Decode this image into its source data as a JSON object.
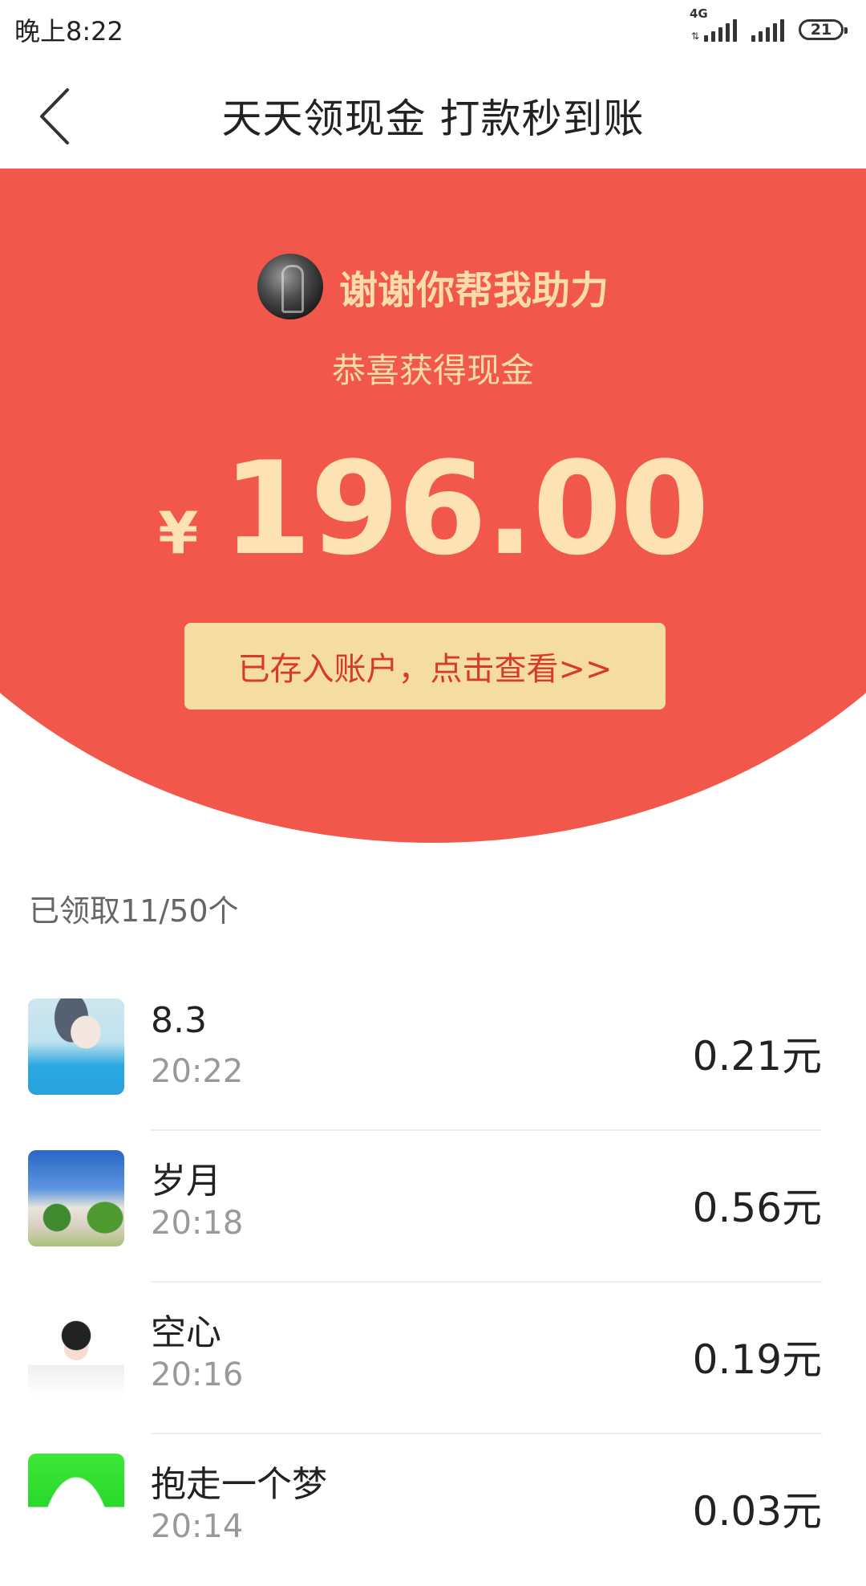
{
  "status_bar": {
    "time": "晚上8:22",
    "network_type": "4G",
    "battery": "21"
  },
  "header": {
    "title": "天天领现金 打款秒到账",
    "back_icon": "chevron-left-icon"
  },
  "hero": {
    "helper_text": "谢谢你帮我助力",
    "congrats": "恭喜获得现金",
    "currency_symbol": "¥",
    "amount": "196.00",
    "account_button": "已存入账户，点击查看>>",
    "bg_color": "#f1574a",
    "text_color": "#fde3b4",
    "button_color": "#f5dca1"
  },
  "received": {
    "label": "已领取11/50个"
  },
  "records": [
    {
      "name": "8.3",
      "time": "20:22",
      "amount": "0.21元"
    },
    {
      "name": "岁月",
      "time": "20:18",
      "amount": "0.56元"
    },
    {
      "name": "空心",
      "time": "20:16",
      "amount": "0.19元"
    },
    {
      "name": "抱走一个梦",
      "time": "20:14",
      "amount": "0.03元"
    }
  ]
}
